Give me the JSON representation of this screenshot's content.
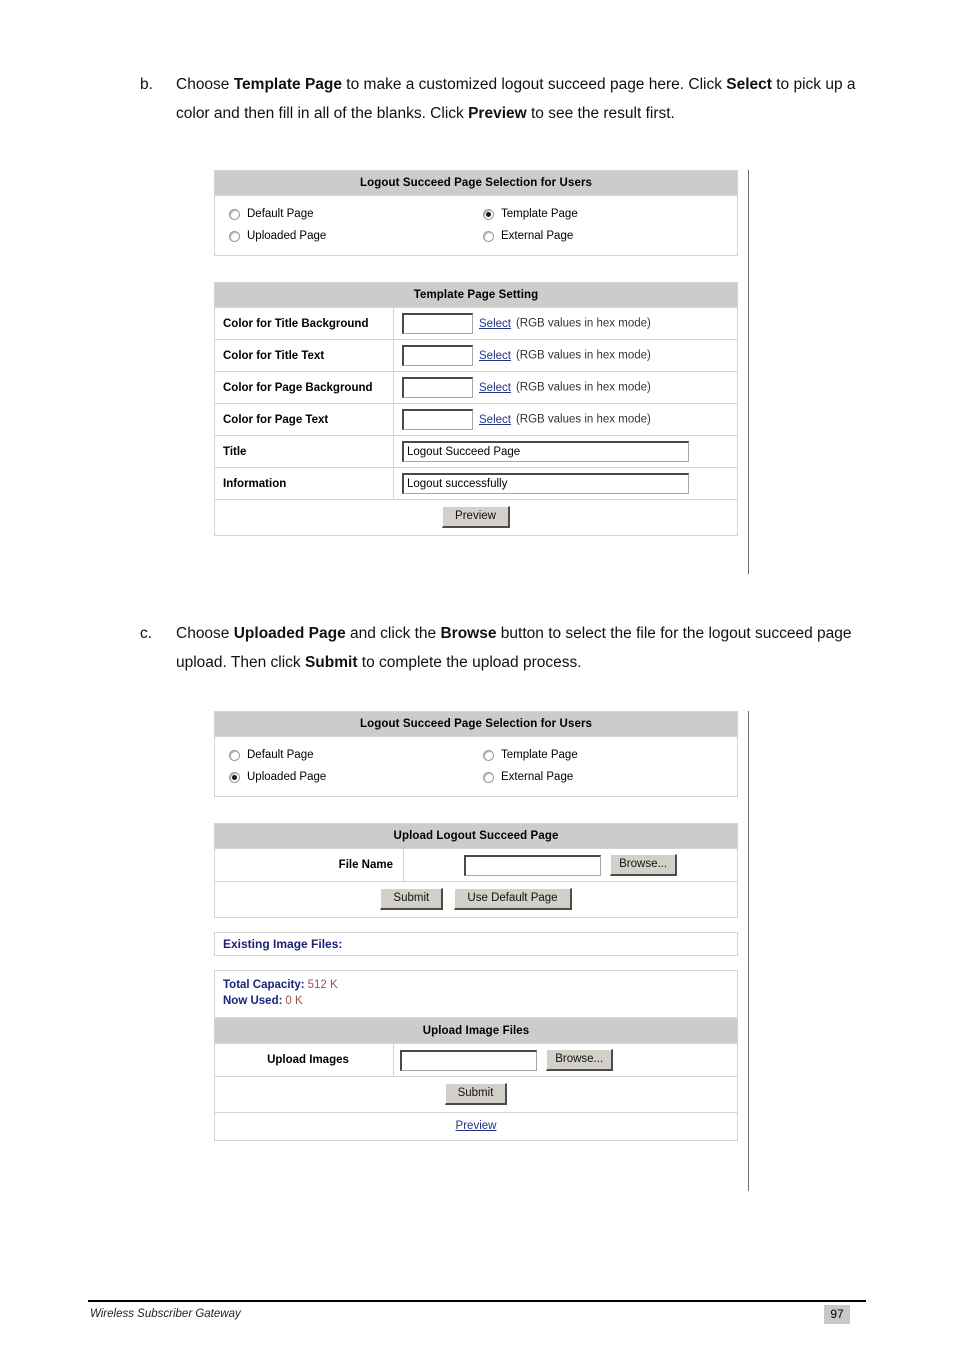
{
  "steps": [
    {
      "marker": "b.",
      "segments": [
        {
          "t": "Choose ",
          "b": false
        },
        {
          "t": "Template Page",
          "b": true
        },
        {
          "t": " to make a customized logout succeed page here. Click ",
          "b": false
        },
        {
          "t": "Select",
          "b": true
        },
        {
          "t": " to pick up a color and then fill in all of the blanks. Click ",
          "b": false
        },
        {
          "t": "Preview",
          "b": true
        },
        {
          "t": " to see the result first.",
          "b": false
        }
      ]
    },
    {
      "marker": "c.",
      "segments": [
        {
          "t": "Choose ",
          "b": false
        },
        {
          "t": "Uploaded Page",
          "b": true
        },
        {
          "t": " and click the ",
          "b": false
        },
        {
          "t": "Browse",
          "b": true
        },
        {
          "t": " button to select the file for the logout succeed page upload. Then click ",
          "b": false
        },
        {
          "t": "Submit",
          "b": true
        },
        {
          "t": " to complete the upload process.",
          "b": false
        }
      ]
    }
  ],
  "screenshot_1": {
    "selection_panel": {
      "title": "Logout Succeed Page Selection for Users",
      "options": [
        {
          "label": "Default Page",
          "selected": false
        },
        {
          "label": "Template Page",
          "selected": true
        },
        {
          "label": "Uploaded Page",
          "selected": false
        },
        {
          "label": "External Page",
          "selected": false
        }
      ]
    },
    "template_panel": {
      "title": "Template Page Setting",
      "color_rows": [
        {
          "label": "Color for Title Background",
          "value": "",
          "link": "Select",
          "hint": "(RGB values in hex mode)"
        },
        {
          "label": "Color for Title Text",
          "value": "",
          "link": "Select",
          "hint": "(RGB values in hex mode)"
        },
        {
          "label": "Color for Page Background",
          "value": "",
          "link": "Select",
          "hint": "(RGB values in hex mode)"
        },
        {
          "label": "Color for Page Text",
          "value": "",
          "link": "Select",
          "hint": "(RGB values in hex mode)"
        }
      ],
      "text_rows": [
        {
          "label": "Title",
          "value": "Logout Succeed Page"
        },
        {
          "label": "Information",
          "value": "Logout successfully"
        }
      ],
      "preview_button": "Preview"
    }
  },
  "screenshot_2": {
    "selection_panel": {
      "title": "Logout Succeed Page Selection for Users",
      "options": [
        {
          "label": "Default Page",
          "selected": false
        },
        {
          "label": "Template Page",
          "selected": false
        },
        {
          "label": "Uploaded Page",
          "selected": true
        },
        {
          "label": "External Page",
          "selected": false
        }
      ]
    },
    "upload_panel": {
      "title": "Upload Logout Succeed Page",
      "file_name_label": "File Name",
      "file_name_value": "",
      "browse_button": "Browse...",
      "submit_button": "Submit",
      "use_default_button": "Use Default Page"
    },
    "existing_files": {
      "heading": "Existing Image Files:",
      "total_capacity_label": "Total Capacity:",
      "total_capacity_value": "512 K",
      "now_used_label": "Now Used:",
      "now_used_value": "0 K"
    },
    "upload_images_panel": {
      "title": "Upload Image Files",
      "upload_label": "Upload Images",
      "upload_value": "",
      "browse_button": "Browse...",
      "submit_button": "Submit",
      "preview_link": "Preview"
    }
  },
  "footer": {
    "document_title": "Wireless Subscriber Gateway",
    "page_number": "97"
  },
  "colors": {
    "panel_header_bg": "#cccccc",
    "link": "#26318c",
    "heading_navy": "#1d2277",
    "capacity_value": "#a05050",
    "button_face": "#d2d0c8",
    "page_badge_bg": "#c8c8c8"
  }
}
